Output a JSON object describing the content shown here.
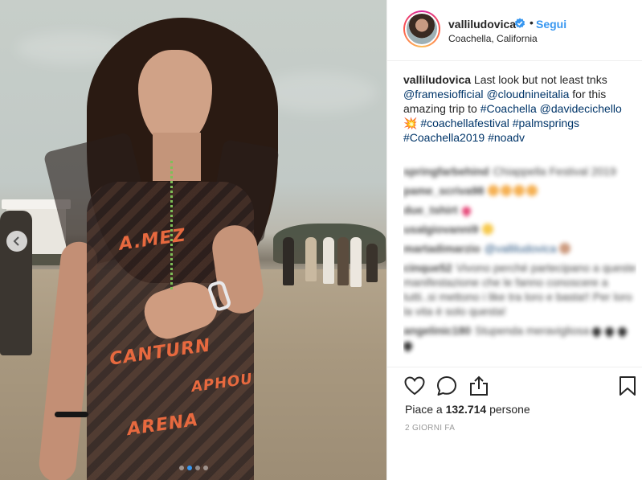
{
  "post": {
    "username": "valliludovica",
    "follow_label": "Segui",
    "separator": "•",
    "location": "Coachella, California",
    "photo_words": [
      "A.MEZ",
      "CANTURN",
      "APHOU",
      "ARENA"
    ]
  },
  "caption": {
    "user": "valliludovica",
    "segments": [
      {
        "text": " Last look but not least tnks ",
        "type": "text"
      },
      {
        "text": "@framesiofficial",
        "type": "link"
      },
      {
        "text": " ",
        "type": "text"
      },
      {
        "text": "@cloudnineitalia",
        "type": "link"
      },
      {
        "text": " for this amazing trip to ",
        "type": "text"
      },
      {
        "text": "#Coachella",
        "type": "link"
      },
      {
        "text": " ",
        "type": "text"
      },
      {
        "text": "@davidecichello",
        "type": "link"
      },
      {
        "text": " 💥 ",
        "type": "text"
      },
      {
        "text": "#coachellafestival",
        "type": "link"
      },
      {
        "text": " ",
        "type": "text"
      },
      {
        "text": "#palmsprings",
        "type": "link"
      },
      {
        "text": " ",
        "type": "text"
      },
      {
        "text": "#Coachella2019",
        "type": "link"
      },
      {
        "text": " ",
        "type": "text"
      },
      {
        "text": "#noadv",
        "type": "link"
      }
    ]
  },
  "comments": [
    {
      "user": "springfarbehind",
      "text": "Chiappella Festival 2019",
      "emoji": []
    },
    {
      "user": "pame_scriva98",
      "text": "",
      "emoji": [
        "face",
        "face",
        "face",
        "face"
      ]
    },
    {
      "user": "due_tshirt",
      "text": "",
      "emoji": [
        "heart"
      ]
    },
    {
      "user": "usalgiovanni9",
      "text": "",
      "emoji": [
        "smile"
      ]
    },
    {
      "user": "martadimarzio",
      "text": "@valliludovica",
      "mention": true,
      "emoji": [
        "hand"
      ]
    },
    {
      "user": "cinque52",
      "text": "Vivono perché partecipano a queste manifestazione che le fanno conoscere a tutti..si mettono i like tra loro e basta!! Per loro la vita è solo questa!",
      "emoji": []
    },
    {
      "user": "angelinic180",
      "text": "Stupenda meravigliosa",
      "emoji": [
        "black-heart",
        "black-heart",
        "black-heart",
        "black-heart"
      ]
    }
  ],
  "actions": {
    "like_icon": "heart-icon",
    "comment_icon": "comment-icon",
    "share_icon": "share-icon",
    "save_icon": "bookmark-icon"
  },
  "likes": {
    "prefix": "Piace a",
    "count": "132.714",
    "suffix": "persone"
  },
  "time_ago": "2 GIORNI FA",
  "carousel": {
    "slides": 4,
    "active": 1
  }
}
